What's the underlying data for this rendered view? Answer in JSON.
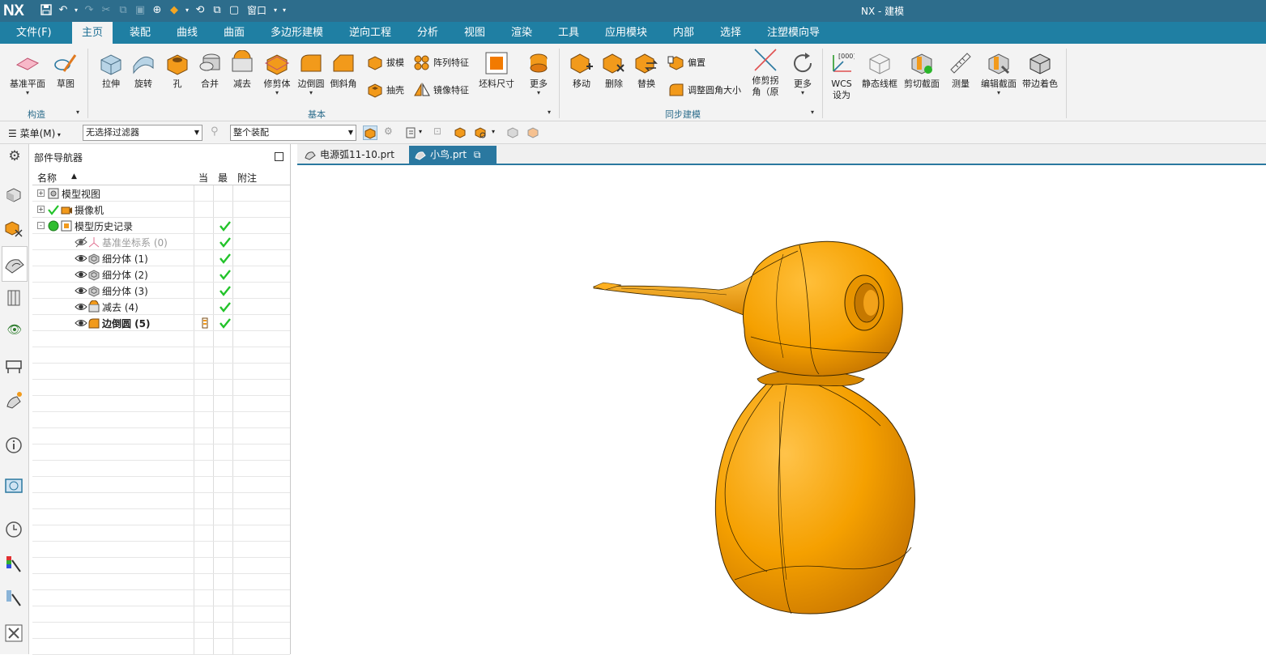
{
  "titlebar": {
    "logo": "NX",
    "title": "NX - 建模",
    "window_menu": "窗口",
    "icons": [
      "save-icon",
      "undo-icon",
      "redo-icon",
      "cut-icon",
      "copy-icon",
      "paste-icon",
      "repeat-command-icon",
      "touch-mode-icon",
      "switch-window-icon",
      "window-icon"
    ]
  },
  "ribbon_tabs": [
    "文件(F)",
    "主页",
    "装配",
    "曲线",
    "曲面",
    "多边形建模",
    "逆向工程",
    "分析",
    "视图",
    "渲染",
    "工具",
    "应用模块",
    "内部",
    "选择",
    "注塑模向导"
  ],
  "active_tab": "主页",
  "ribbon": {
    "construct": {
      "datum_plane": "基准平面",
      "sketch": "草图",
      "label": "构造"
    },
    "basic": {
      "extrude": "拉伸",
      "revolve": "旋转",
      "hole": "孔",
      "unite": "合并",
      "subtract": "减去",
      "trim_body": "修剪体",
      "edge_blend": "边倒圆",
      "chamfer": "倒斜角",
      "draft": "拔模",
      "shell": "抽壳",
      "pattern_feature": "阵列特征",
      "mirror_feature": "镜像特征",
      "stock_size": "坯料尺寸",
      "more": "更多",
      "label": "基本"
    },
    "sync": {
      "move": "移动",
      "delete": "删除",
      "replace": "替换",
      "offset": "偏置",
      "resize_blend": "调整圆角大小",
      "trim_corner": "修剪拐角（原",
      "more": "更多",
      "label": "同步建模"
    },
    "misc": {
      "wcs": "WCS 设为",
      "static_wireframe": "静态线框",
      "clip_section": "剪切截面",
      "measure": "测量",
      "edit_section": "编辑截面",
      "shaded_edges": "带边着色"
    }
  },
  "command_bar": {
    "menu_label": "菜单(M)",
    "selection_filter": "无选择过滤器",
    "assembly_scope": "整个装配"
  },
  "part_navigator": {
    "title": "部件导航器",
    "columns": {
      "name": "名称",
      "current": "当",
      "latest": "最",
      "comment": "附注"
    },
    "rows": [
      {
        "name": "模型视图",
        "indent": 0,
        "expander": "+",
        "icon": "model-views-icon",
        "check": false,
        "style": "normal"
      },
      {
        "name": "摄像机",
        "indent": 0,
        "expander": "+",
        "icon": "camera-icon",
        "check": false,
        "style": "normal"
      },
      {
        "name": "模型历史记录",
        "indent": 0,
        "expander": "-",
        "icon": "history-icon",
        "check": true,
        "style": "normal"
      },
      {
        "name": "基准坐标系 (0)",
        "indent": 1,
        "expander": "",
        "icon": "datum-csys-icon",
        "check": true,
        "style": "gray"
      },
      {
        "name": "细分体 (1)",
        "indent": 1,
        "expander": "",
        "icon": "subdivision-body-icon",
        "check": true,
        "style": "normal"
      },
      {
        "name": "细分体 (2)",
        "indent": 1,
        "expander": "",
        "icon": "subdivision-body-icon",
        "check": true,
        "style": "normal"
      },
      {
        "name": "细分体 (3)",
        "indent": 1,
        "expander": "",
        "icon": "subdivision-body-icon",
        "check": true,
        "style": "normal"
      },
      {
        "name": "减去 (4)",
        "indent": 1,
        "expander": "",
        "icon": "subtract-icon",
        "check": true,
        "style": "normal"
      },
      {
        "name": "边倒圆 (5)",
        "indent": 1,
        "expander": "",
        "icon": "edge-blend-icon",
        "check": true,
        "style": "bold"
      }
    ]
  },
  "doc_tabs": [
    {
      "label": "电源弧11-10.prt",
      "active": false
    },
    {
      "label": "小鸟.prt",
      "active": true
    }
  ],
  "model": {
    "description_color": "#f5a000",
    "edge_color": "#2b1d00"
  },
  "colors": {
    "titlebar": "#2d6d8c",
    "ribbon_tabs": "#1f7fa3",
    "accent": "#2a78a0",
    "check": "#22c32a",
    "orange": "#f29a1b"
  }
}
